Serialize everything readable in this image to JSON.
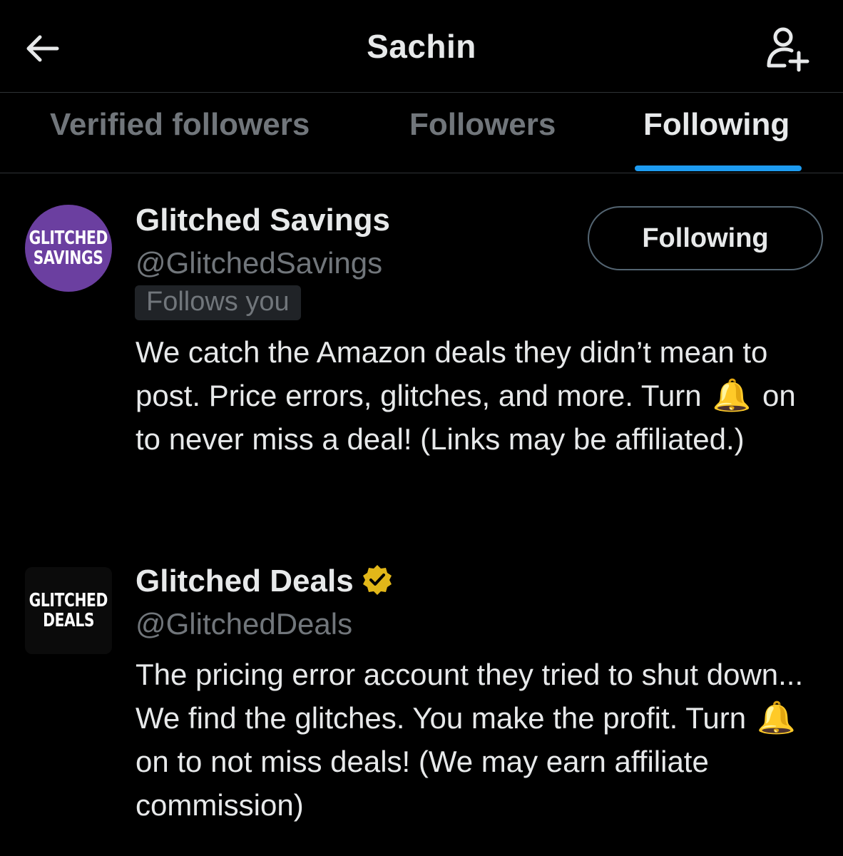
{
  "header": {
    "title": "Sachin",
    "back_icon": "arrow-left-icon",
    "add_user_icon": "person-add-icon"
  },
  "tabs": [
    {
      "label": "Verified followers",
      "active": false
    },
    {
      "label": "Followers",
      "active": false
    },
    {
      "label": "Following",
      "active": true
    }
  ],
  "accounts": [
    {
      "avatar_lines": [
        "GLITCHED",
        "SAVINGS"
      ],
      "name": "Glitched Savings",
      "handle": "@GlitchedSavings",
      "follows_you": "Follows you",
      "button_label": "Following",
      "bio_parts": [
        "We catch the Amazon deals they didn’t mean to post. Price errors, glitches, and more. Turn",
        "on to never miss a deal! (Links may be affiliated.)"
      ],
      "verified": false
    },
    {
      "avatar_lines": [
        "GLITCHED",
        "DEALS"
      ],
      "name": "Glitched Deals",
      "handle": "@GlitchedDeals",
      "bio_parts": [
        "The pricing error account they tried to shut down... We find the glitches. You make the profit. Turn",
        "on to not miss deals! (We may earn affiliate commission)"
      ],
      "verified": true
    }
  ],
  "colors": {
    "background": "#000000",
    "text_primary": "#e7e9ea",
    "text_secondary": "#71767b",
    "accent": "#1d9bf0",
    "verified_gold": "#e2b719",
    "avatar_purple": "#6b3fa0"
  }
}
